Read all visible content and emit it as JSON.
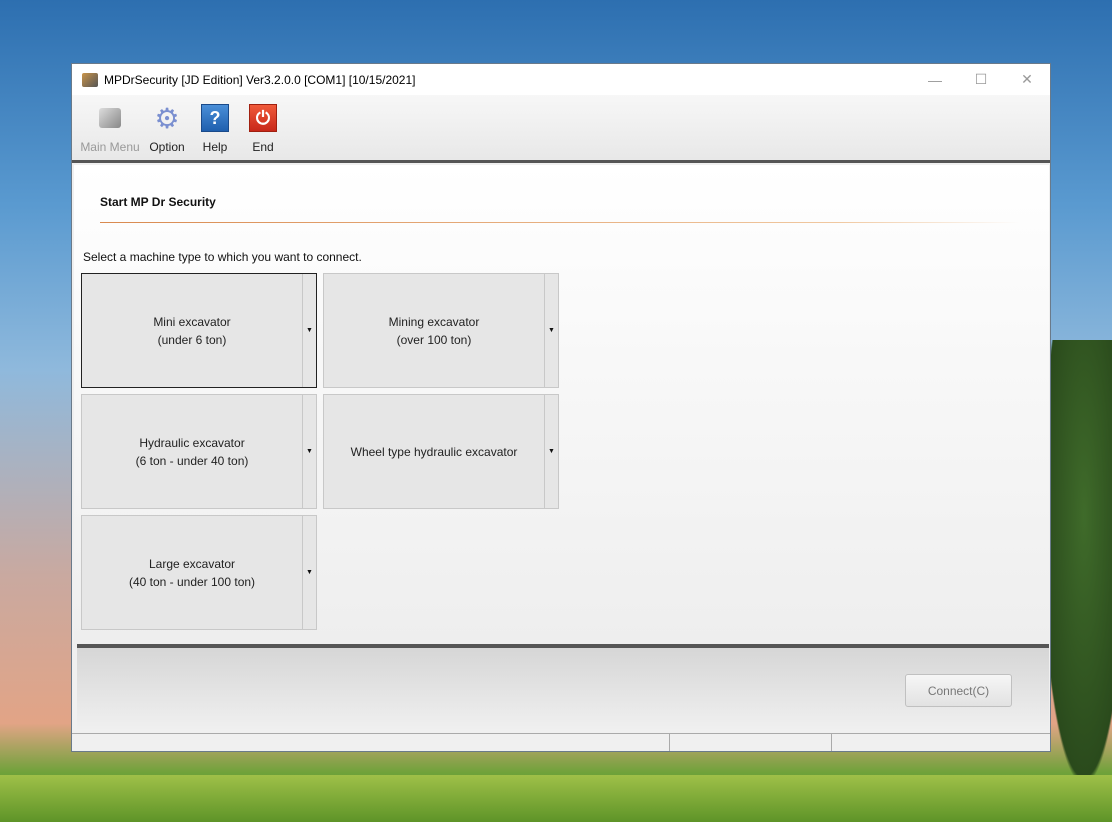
{
  "window": {
    "title": "MPDrSecurity [JD Edition] Ver3.2.0.0 [COM1] [10/15/2021]"
  },
  "toolbar": {
    "items": [
      {
        "label": "Main Menu",
        "icon": "main-menu-icon"
      },
      {
        "label": "Option",
        "icon": "gear-icon"
      },
      {
        "label": "Help",
        "icon": "help-icon"
      },
      {
        "label": "End",
        "icon": "power-icon"
      }
    ]
  },
  "main": {
    "heading": "Start MP Dr Security",
    "instruction": "Select a machine type to which you want to connect.",
    "machines": [
      {
        "line1": "Mini excavator",
        "line2": "(under 6 ton)"
      },
      {
        "line1": "Mining excavator",
        "line2": "(over 100 ton)"
      },
      {
        "line1": "Hydraulic excavator",
        "line2": "(6 ton - under 40 ton)"
      },
      {
        "line1": "Wheel type hydraulic excavator",
        "line2": ""
      },
      {
        "line1": "Large excavator",
        "line2": "(40 ton - under 100 ton)"
      }
    ]
  },
  "footer": {
    "connect_label": "Connect(C)"
  }
}
